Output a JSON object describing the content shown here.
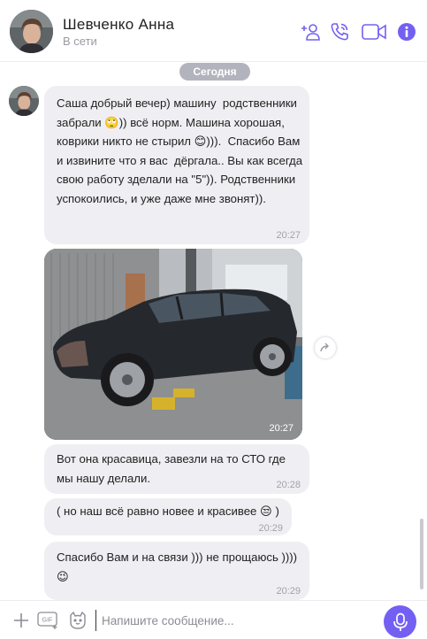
{
  "header": {
    "name": "Шевченко Анна",
    "status": "В сети",
    "icons": [
      "add-contact-icon",
      "phone-icon",
      "video-icon",
      "info-icon"
    ],
    "accent_color": "#7360f2"
  },
  "chat": {
    "date_separator": "Сегодня",
    "messages": [
      {
        "text": "Саша добрый вечер) машину  родственники забрали 🙄)) всё норм. Машина хорошая, коврики никто не стырил 😊))).  Спасибо Вам и извините что я вас  дёргала.. Вы как всегда свою работу зделали на \"5\")). Родственники успокоились, и уже даже мне звонят)).",
        "time": "20:27"
      },
      {
        "type": "photo",
        "description_icon": "car-photo",
        "time": "20:27"
      },
      {
        "text": "Вот она красавица, завезли на то СТО где мы нашу делали.",
        "time": "20:28"
      },
      {
        "text": "( но наш всё равно новее и красивее 😒 )",
        "time": "20:29"
      },
      {
        "text": "Спасибо Вам и на связи ))) не прощаюсь ))))\n😉",
        "time": "20:29"
      }
    ]
  },
  "composer": {
    "placeholder": "Напишите сообщение...",
    "gif_label": "GIF",
    "icons": [
      "plus-icon",
      "gif-icon",
      "sticker-icon",
      "microphone-icon"
    ]
  }
}
